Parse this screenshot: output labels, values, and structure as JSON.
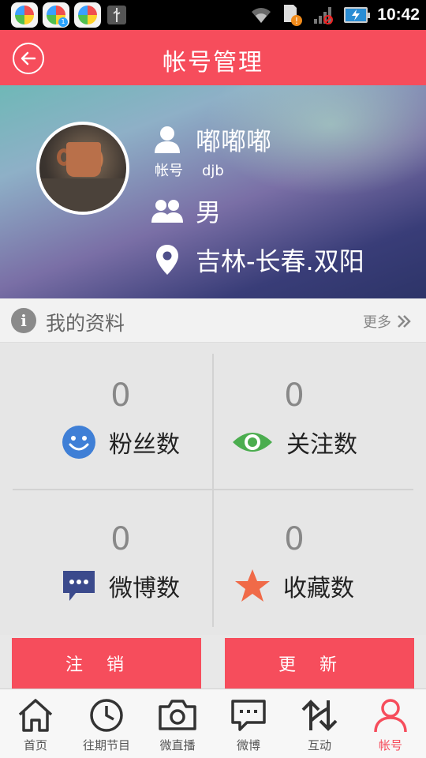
{
  "status_bar": {
    "time": "10:42",
    "app_badge": "1"
  },
  "header": {
    "title": "帐号管理"
  },
  "profile": {
    "nickname": "嘟嘟嘟",
    "account_label": "帐号",
    "account_value": "djb",
    "gender": "男",
    "location": "吉林-长春.双阳"
  },
  "section": {
    "title": "我的资料",
    "more_label": "更多"
  },
  "stats": [
    {
      "value": "0",
      "label": "粉丝数",
      "icon": "smiley-icon",
      "color": "#3f7fd6"
    },
    {
      "value": "0",
      "label": "关注数",
      "icon": "eye-icon",
      "color": "#4bad4f"
    },
    {
      "value": "0",
      "label": "微博数",
      "icon": "speech-bubble-icon",
      "color": "#3b4a8c"
    },
    {
      "value": "0",
      "label": "收藏数",
      "icon": "star-icon",
      "color": "#f06a48"
    }
  ],
  "buttons": {
    "logout": "注销",
    "update": "更新"
  },
  "tabs": [
    {
      "label": "首页",
      "icon": "home-icon"
    },
    {
      "label": "往期节目",
      "icon": "clock-icon"
    },
    {
      "label": "微直播",
      "icon": "camera-icon"
    },
    {
      "label": "微博",
      "icon": "chat-icon"
    },
    {
      "label": "互动",
      "icon": "swap-arrows-icon"
    },
    {
      "label": "帐号",
      "icon": "person-icon",
      "active": true
    }
  ],
  "colors": {
    "accent": "#f64d5c"
  }
}
